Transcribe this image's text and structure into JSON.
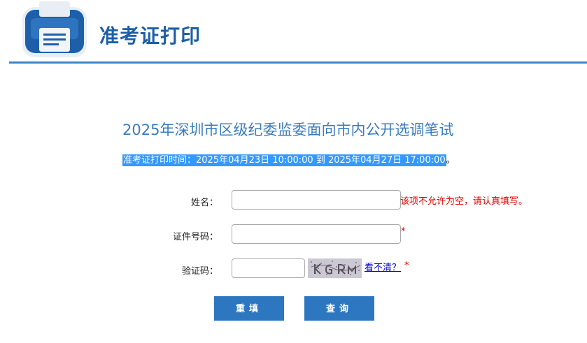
{
  "header": {
    "title": "准考证打印"
  },
  "exam": {
    "title": "2025年深圳市区级纪委监委面向市内公开选调笔试",
    "print_time_highlight": "准考证打印时间：2025年04月23日 10:00:00 到 2025年04月27日 17:00:00",
    "print_time_tail": "。"
  },
  "form": {
    "name_label": "姓名：",
    "name_value": "",
    "name_error": "该项不允许为空，请认真填写。",
    "id_label": "证件号码：",
    "id_value": "",
    "id_required": "*",
    "captcha_label": "验证码：",
    "captcha_value": "",
    "captcha_refresh": "看不清？",
    "captcha_required": "*"
  },
  "buttons": {
    "reset": "重填",
    "query": "查询"
  },
  "colors": {
    "brand_blue": "#1c5fa8",
    "accent_blue": "#2d77c0",
    "error_red": "#e10000"
  }
}
